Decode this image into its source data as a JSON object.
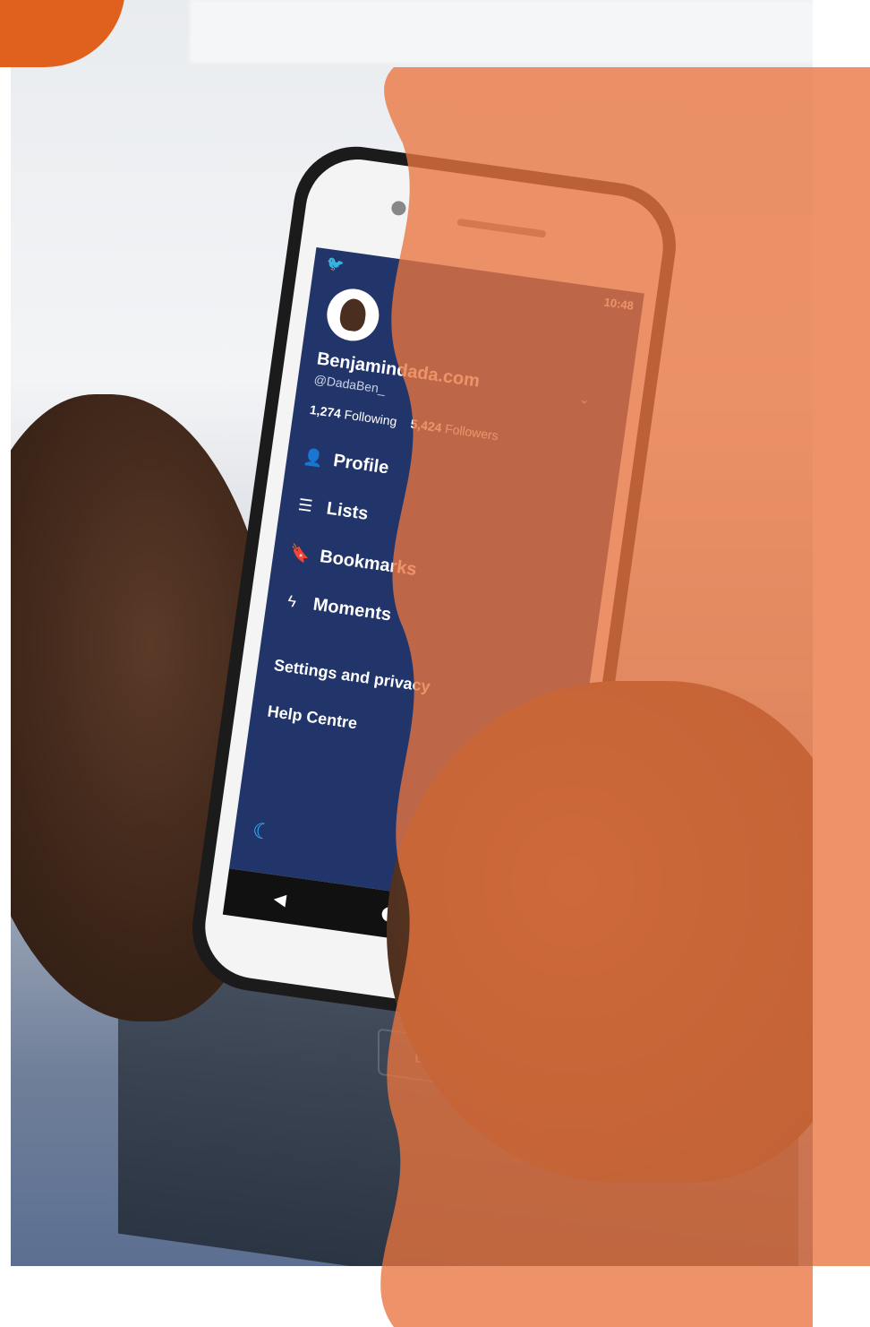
{
  "background": {
    "monitor_text": "",
    "monitor_title": ""
  },
  "phone": {
    "status_time": "10:48",
    "profile": {
      "name": "Benjamindada.com",
      "handle": "@DadaBen_",
      "following_count": "1,274",
      "following_label": "Following",
      "followers_count": "5,424",
      "followers_label": "Followers"
    },
    "menu": [
      {
        "label": "Profile",
        "icon": "person-icon"
      },
      {
        "label": "Lists",
        "icon": "list-icon"
      },
      {
        "label": "Bookmarks",
        "icon": "bookmark-icon"
      },
      {
        "label": "Moments",
        "icon": "lightning-icon"
      }
    ],
    "secondary_menu": [
      {
        "label": "Settings and privacy"
      },
      {
        "label": "Help Centre"
      }
    ]
  },
  "keyboard": {
    "keys": [
      "B",
      "N"
    ]
  },
  "colors": {
    "overlay_orange": "#e9753f",
    "corner_orange": "#e0601e",
    "screen_blue": "#22356a",
    "moon_blue": "#36b7ff"
  }
}
